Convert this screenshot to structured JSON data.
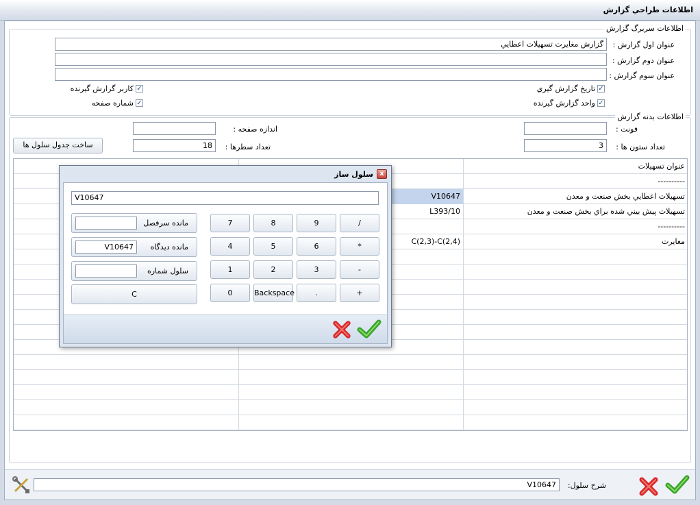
{
  "window": {
    "title": "اطلاعات طراحي گزارش"
  },
  "header_group": {
    "legend": "اطلاعات سربرگ گزارش",
    "title1_label": "عنوان اول گزارش :",
    "title1_value": "گزارش مغايرت تسهيلات اعطايي",
    "title2_label": "عنوان دوم گزارش :",
    "title2_value": "",
    "title3_label": "عنوان سوم گزارش :",
    "title3_value": "",
    "checkboxes": [
      {
        "label": "تاريخ گزارش گيري",
        "checked": true
      },
      {
        "label": "كاربر گزارش گيرنده",
        "checked": true
      },
      {
        "label": "واحد گزارش گيرنده",
        "checked": true
      },
      {
        "label": "شماره صفحه",
        "checked": true
      }
    ]
  },
  "body_group": {
    "legend": "اطلاعات بدنه گزارش",
    "font_label": "فونت :",
    "font_value": "",
    "page_size_label": "اندازه صفحه :",
    "page_size_value": "",
    "columns_label": "تعداد ستون ها :",
    "columns_value": "3",
    "rows_label": "تعداد سطرها :",
    "rows_value": "18",
    "build_button": "ساخت جدول سلول ها"
  },
  "grid": {
    "rows": [
      [
        "",
        "",
        "عنوان تسهيلات"
      ],
      [
        "",
        "",
        "----------"
      ],
      [
        "",
        "V10647",
        "تسهيلات اعطايي بخش صنعت و معدن"
      ],
      [
        "",
        "L393/10",
        "تسهيلات پيش بيني شده براي بخش صنعت و معدن"
      ],
      [
        "",
        "",
        "----------"
      ],
      [
        "",
        "(C(2,3)-C(2,4",
        "مغايرت"
      ]
    ]
  },
  "dialog": {
    "title": "سلول ساز",
    "close_glyph": "x",
    "expression": "V10647",
    "field1_label": "مانده سرفصل",
    "field1_value": "",
    "field2_label": "مانده ديدگاه",
    "field2_value": "V10647",
    "field3_label": "سلول شماره",
    "field3_value": "",
    "clear_label": "C",
    "keys": {
      "k7": "7",
      "k8": "8",
      "k9": "9",
      "div": "/",
      "k4": "4",
      "k5": "5",
      "k6": "6",
      "mul": "*",
      "k1": "1",
      "k2": "2",
      "k3": "3",
      "sub": "-",
      "k0": "0",
      "back": "Backspace",
      "dot": ".",
      "add": "+"
    }
  },
  "footer": {
    "cell_desc_label": "شرح سلول:",
    "cell_desc_value": "V10647"
  },
  "colors": {
    "accept": "#3aa52a",
    "cancel": "#d8262a",
    "selection": "#c4d4ec"
  }
}
